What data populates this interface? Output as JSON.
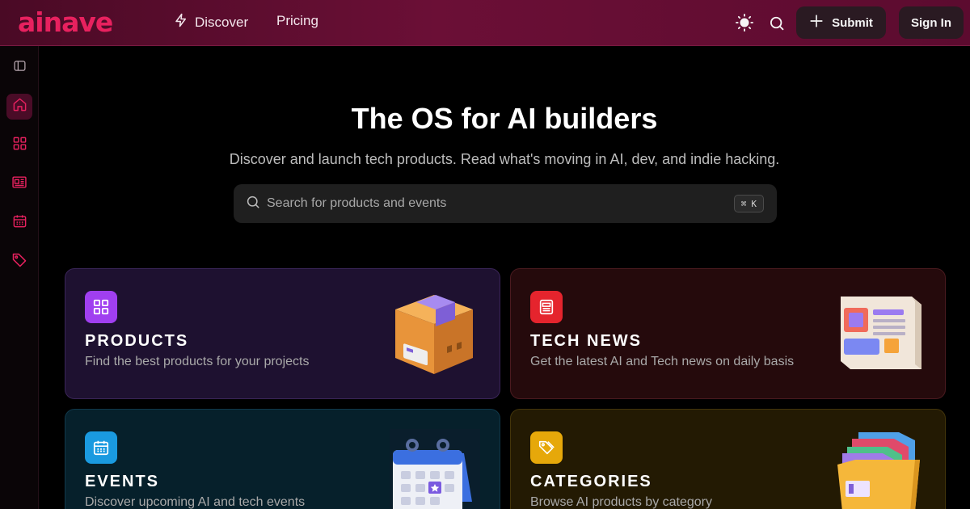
{
  "brand": {
    "name": "ainave",
    "accent": "#e8215f"
  },
  "header": {
    "nav": [
      {
        "label": "Discover",
        "icon": "lightning-icon"
      },
      {
        "label": "Pricing"
      }
    ],
    "submit_label": "Submit",
    "signin_label": "Sign In"
  },
  "sidebar": {
    "items": [
      {
        "name": "panel-toggle",
        "icon": "sidebar-panel-icon"
      },
      {
        "name": "home",
        "icon": "home-icon",
        "active": true
      },
      {
        "name": "products",
        "icon": "grid-icon"
      },
      {
        "name": "news",
        "icon": "newspaper-icon"
      },
      {
        "name": "events",
        "icon": "calendar-icon"
      },
      {
        "name": "categories",
        "icon": "tag-icon"
      }
    ]
  },
  "hero": {
    "title": "The OS for AI builders",
    "subtitle": "Discover and launch tech products. Read what's moving in AI, dev, and indie hacking.",
    "search_placeholder": "Search for products and events",
    "shortcut": {
      "symbol": "⌘",
      "key": "K"
    }
  },
  "cards": [
    {
      "title": "PRODUCTS",
      "description": "Find the best products for your projects",
      "icon_color": "#a03ff0"
    },
    {
      "title": "TECH NEWS",
      "description": "Get the latest AI and Tech news on daily basis",
      "icon_color": "#e5242d"
    },
    {
      "title": "EVENTS",
      "description": "Discover upcoming AI and tech events",
      "icon_color": "#1a9ae0"
    },
    {
      "title": "CATEGORIES",
      "description": "Browse AI products by category",
      "icon_color": "#e6a80a"
    }
  ]
}
